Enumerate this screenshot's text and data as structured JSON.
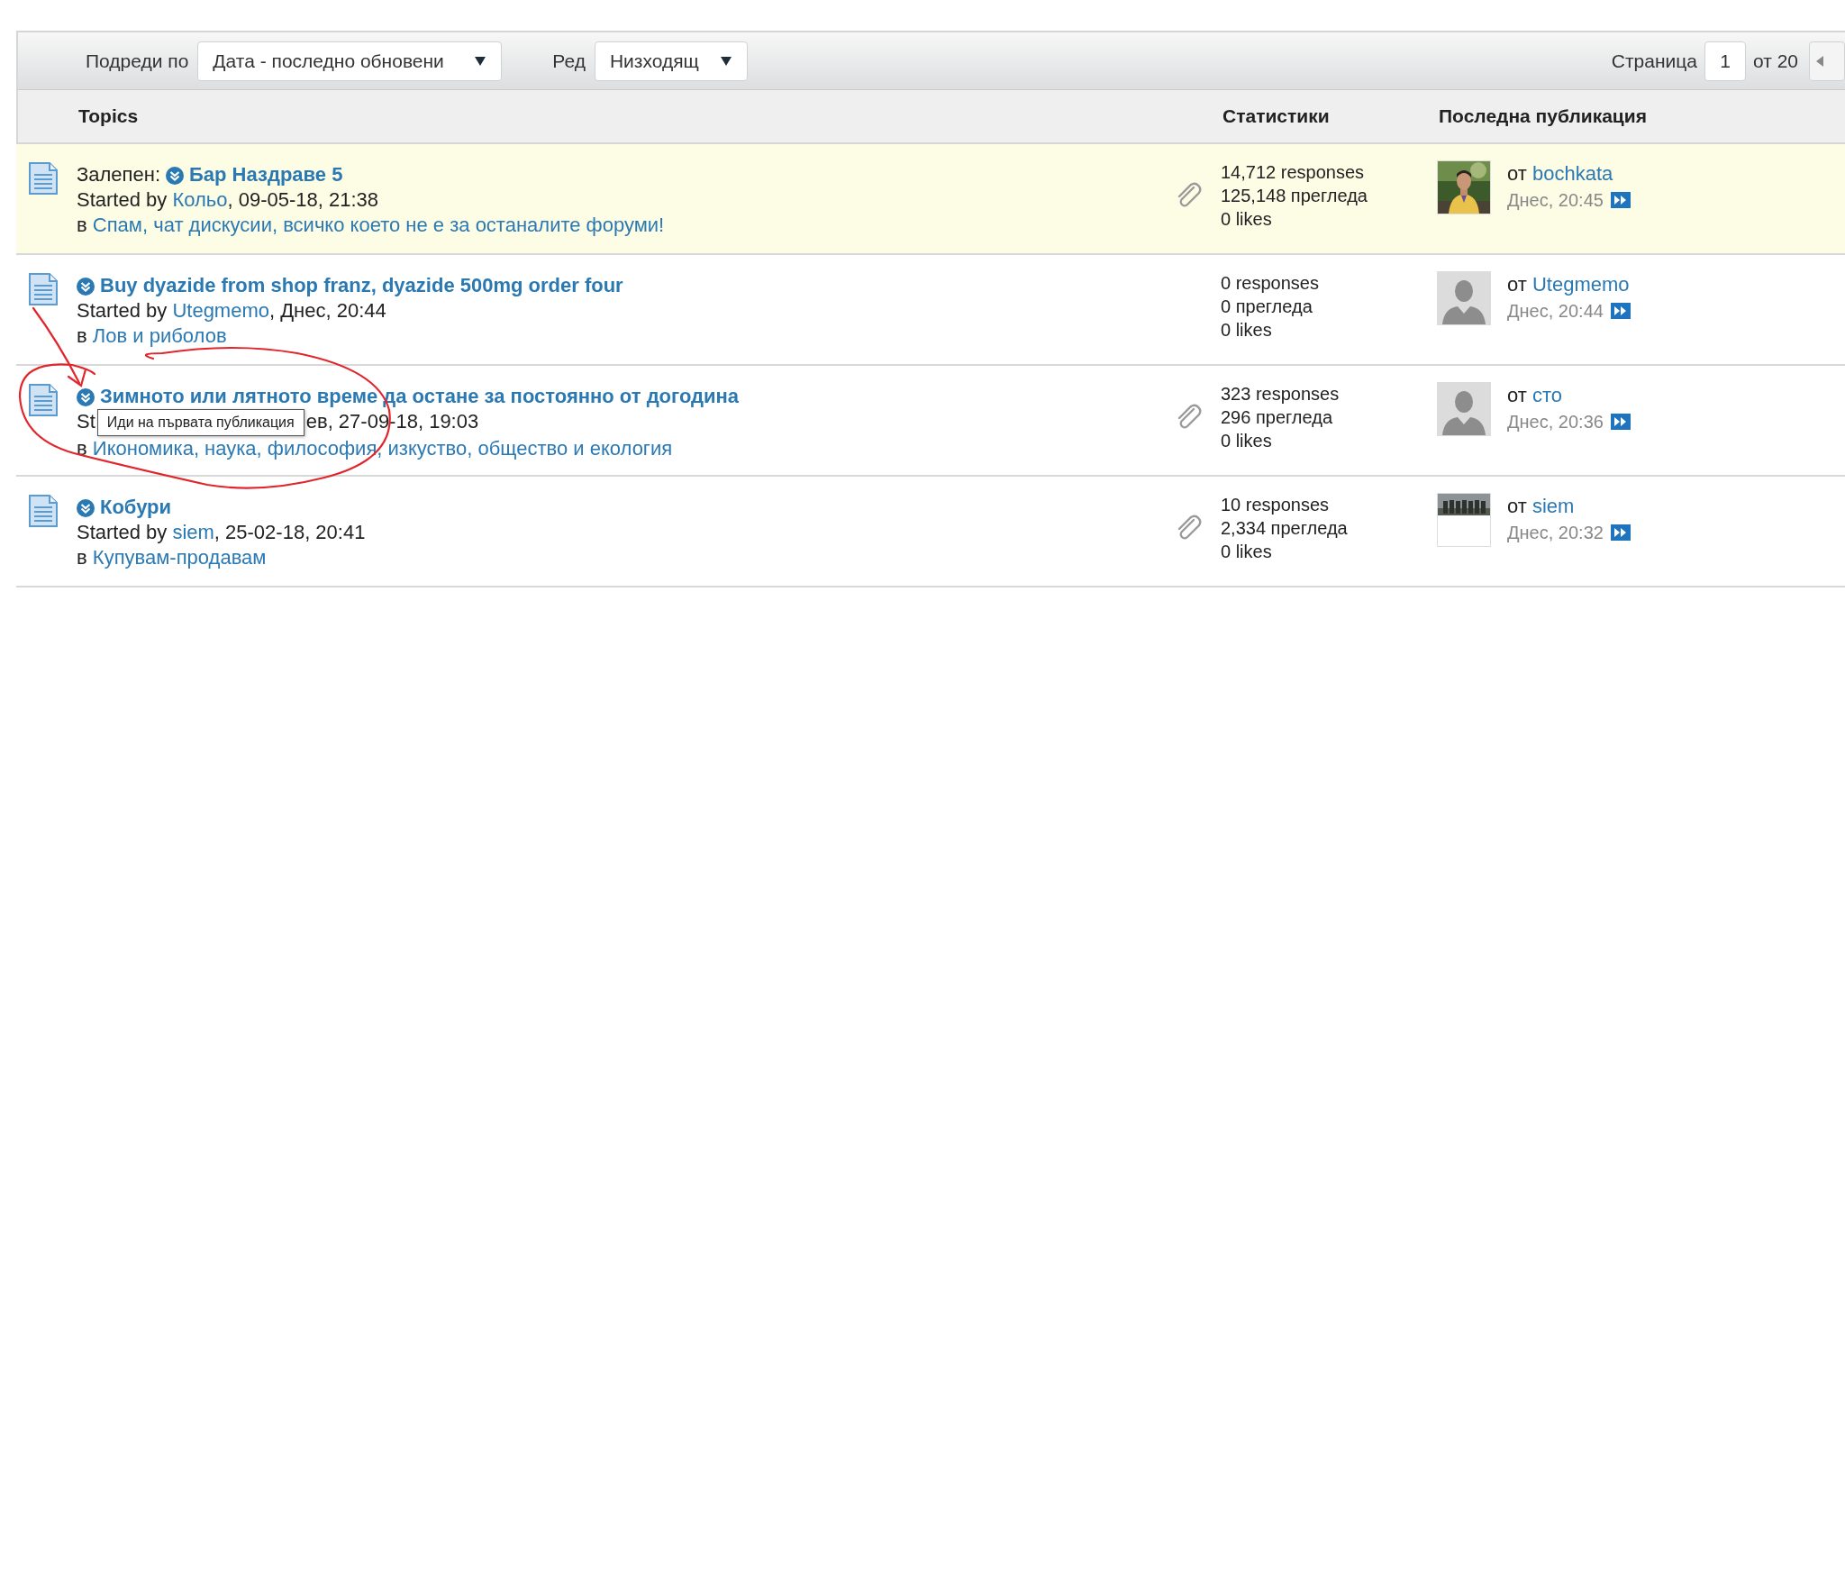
{
  "toolbar": {
    "sort_label": "Подреди по",
    "sort_value": "Дата - последно обновени",
    "order_label": "Ред",
    "order_value": "Низходящ",
    "page_label": "Страница",
    "page_value": "1",
    "page_total": "от 20"
  },
  "columns": [
    "Topics",
    "Статистики",
    "Последна публикация"
  ],
  "rows": [
    {
      "sticky": true,
      "sticky_label": "Залепен:",
      "title": "Бар Наздраве 5",
      "started_prefix": "Started by",
      "author": "Кольо",
      "date": ", 09-05-18, 21:38",
      "in_prefix": "в",
      "forum": "Спам, чат дискусии, всичко което не е за останалите форуми!",
      "attachment": true,
      "responses": "14,712 responses",
      "views": "125,148 прегледа",
      "likes": "0 likes",
      "last_prefix": "от",
      "last_author": "bochkata",
      "last_time": "Днес, 20:45"
    },
    {
      "sticky": false,
      "title": "Buy dyazide from shop franz, dyazide 500mg order four",
      "started_prefix": "Started by",
      "author": "Utegmemo",
      "date": ", Днес, 20:44",
      "in_prefix": "в",
      "forum": "Лов и риболов",
      "attachment": false,
      "responses": "0 responses",
      "views": "0 прегледа",
      "likes": "0 likes",
      "last_prefix": "от",
      "last_author": "Utegmemo",
      "last_time": "Днес, 20:44",
      "avatar": {
        "kind": "default"
      }
    },
    {
      "sticky": false,
      "title": "Зимното или лятното време да остане за постоянно от догодина",
      "started_prefix": "St",
      "date": "ев, 27-09-18, 19:03",
      "in_prefix": "в",
      "forum": "Икономика, наука, философия, изкуство, общество и екология",
      "attachment": true,
      "responses": "323 responses",
      "views": "296 прегледа",
      "likes": "0 likes",
      "last_prefix": "от",
      "last_author": "сто",
      "last_time": "Днес, 20:36",
      "avatar": {
        "kind": "default"
      },
      "tooltip": "Иди на първата публикация"
    },
    {
      "sticky": false,
      "title": "Кобури",
      "started_prefix": "Started by",
      "author": "siem",
      "date": ", 25-02-18, 20:41",
      "in_prefix": "в",
      "forum": "Купувам-продавам",
      "attachment": true,
      "responses": "10 responses",
      "views": "2,334 прегледа",
      "likes": "0 likes",
      "last_prefix": "от",
      "last_author": "siem",
      "last_time": "Днес, 20:32",
      "avatar": {
        "kind": "group"
      }
    }
  ]
}
